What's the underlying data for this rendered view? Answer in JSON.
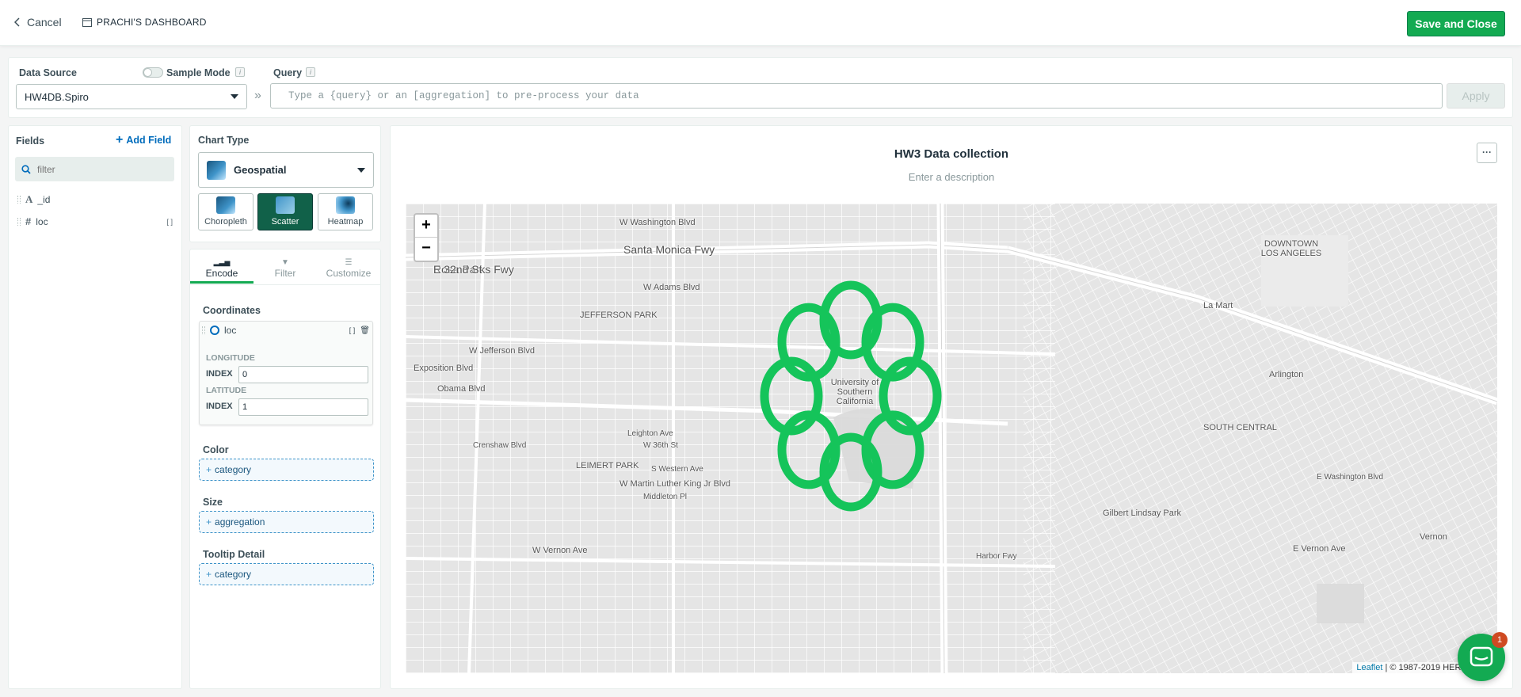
{
  "header": {
    "cancel_label": "Cancel",
    "dashboard_label": "PRACHI'S DASHBOARD",
    "save_label": "Save and Close"
  },
  "datasource": {
    "label": "Data Source",
    "value": "HW4DB.Spiro",
    "sample_mode_label": "Sample Mode",
    "info": "i",
    "separator": "»"
  },
  "query": {
    "label": "Query",
    "info": "i",
    "placeholder": "Type a {query} or an [aggregation] to pre-process your data",
    "apply_label": "Apply"
  },
  "fields": {
    "title": "Fields",
    "add_label": "Add Field",
    "filter_placeholder": "filter",
    "items": [
      {
        "name": "_id",
        "type_glyph": "A"
      },
      {
        "name": "loc",
        "type_glyph": "#",
        "array_badge": "[ ]"
      }
    ]
  },
  "chart_type": {
    "label": "Chart Type",
    "selected": "Geospatial",
    "options": [
      {
        "label": "Choropleth"
      },
      {
        "label": "Scatter"
      },
      {
        "label": "Heatmap"
      }
    ]
  },
  "tabs": [
    {
      "label": "Encode"
    },
    {
      "label": "Filter"
    },
    {
      "label": "Customize"
    }
  ],
  "encode": {
    "coordinates_label": "Coordinates",
    "coord_field": "loc",
    "longitude_label": "LONGITUDE",
    "latitude_label": "LATITUDE",
    "index_label": "INDEX",
    "longitude_index": "0",
    "latitude_index": "1",
    "color_label": "Color",
    "color_placeholder": "category",
    "size_label": "Size",
    "size_placeholder": "aggregation",
    "tooltip_label": "Tooltip Detail",
    "tooltip_placeholder": "category"
  },
  "chart": {
    "title": "HW3 Data collection",
    "description_placeholder": "Enter a description",
    "menu_glyph": "···",
    "zoom_in": "+",
    "zoom_out": "−",
    "attribution_link": "Leaflet",
    "attribution_text": "| © 1987-2019 HERE | Term",
    "point_color": "#15c45a"
  },
  "map_labels": [
    "Santa Monica Fwy",
    "Rosa Parks Fwy",
    "W Washington Blvd",
    "W Adams Blvd",
    "W Jefferson Blvd",
    "JEFFERSON PARK",
    "Exposition Blvd",
    "Obama Blvd",
    "LEIMERT PARK",
    "W Martin Luther King Jr Blvd",
    "W Vernon Ave",
    "University of Southern California",
    "SOUTH CENTRAL",
    "DOWNTOWN LOS ANGELES",
    "La Mart",
    "Harbor Fwy",
    "Gilbert Lindsay Park",
    "Vernon",
    "E Vernon Ave",
    "Crenshaw Blvd",
    "S Western Ave",
    "W 36th St",
    "Leighton Ave",
    "Middleton Pl",
    "Arlington",
    "E Washington Blvd",
    "Santa Monica Fwy",
    "E 32nd St"
  ],
  "chat": {
    "badge_count": "1"
  }
}
